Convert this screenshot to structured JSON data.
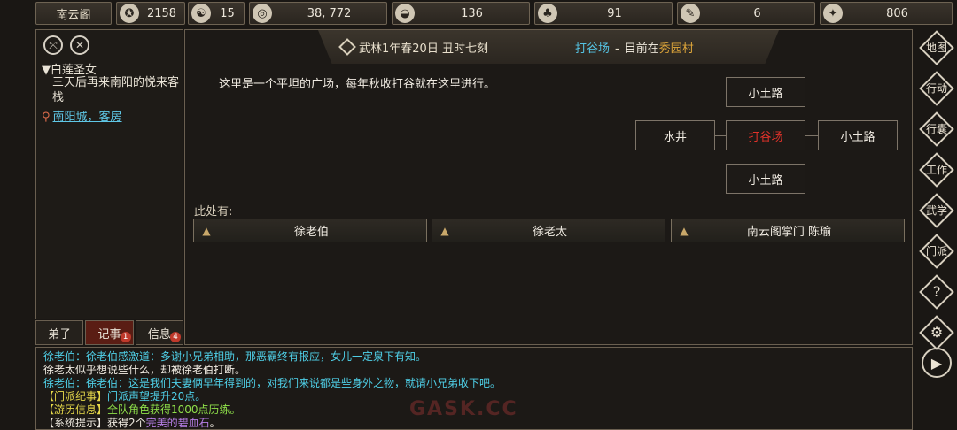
{
  "topbar": {
    "title": "南云阁",
    "stats": [
      {
        "icon": "prestige-icon",
        "glyph": "✪",
        "value": "2158"
      },
      {
        "icon": "yinyang-icon",
        "glyph": "☯",
        "value": "15"
      },
      {
        "icon": "coin-icon",
        "glyph": "◎",
        "value": "38, 772"
      },
      {
        "icon": "food-bowl-icon",
        "glyph": "◒",
        "value": "136"
      },
      {
        "icon": "herb-icon",
        "glyph": "♣",
        "value": "91"
      },
      {
        "icon": "scroll-icon",
        "glyph": "✎",
        "value": "6"
      },
      {
        "icon": "beast-icon",
        "glyph": "✦",
        "value": "806"
      }
    ]
  },
  "left": {
    "task_title": "▼白莲圣女",
    "task_desc": "三天后再来南阳的悦来客栈",
    "task_location": "南阳城，客房"
  },
  "tabs": [
    {
      "label": "弟子",
      "badge": ""
    },
    {
      "label": "记事",
      "badge": "1"
    },
    {
      "label": "信息",
      "badge": "4"
    }
  ],
  "header": {
    "date": "武林1年春20日 丑时七刻",
    "place": "打谷场",
    "separator": "-",
    "current_prefix": "目前在",
    "village": "秀园村"
  },
  "scene": {
    "description": "这里是一个平坦的广场，每年秋收打谷就在这里进行。",
    "map": {
      "north": "小土路",
      "west": "水井",
      "center": "打谷场",
      "east": "小土路",
      "south": "小土路"
    },
    "here_label": "此处有:",
    "npcs": [
      "徐老伯",
      "徐老太",
      "南云阁掌门 陈瑜"
    ]
  },
  "log": {
    "line1": "徐老伯：徐老伯感激道：多谢小兄弟相助，那恶霸终有报应，女儿一定泉下有知。",
    "line2": "徐老太似乎想说些什么，却被徐老伯打断。",
    "line3": "徐老伯：徐老伯：这是我们夫妻俩早年得到的，对我们来说都是些身外之物，就请小兄弟收下吧。",
    "line4_tag": "【门派纪事】",
    "line4_text": "门派声望提升20点。",
    "line5_tag": "【游历信息】",
    "line5_text": "全队角色获得1000点历练。",
    "line6_tag": "【系统提示】",
    "line6_text": "获得2个",
    "line6_item": "完美的碧血石",
    "line6_end": "。"
  },
  "watermark": "GASK.CC",
  "rightbar": {
    "map": "地图",
    "action": "行动",
    "bag": "行囊",
    "work": "工作",
    "martial": "武学",
    "sect": "门派",
    "help": "?",
    "settings": "⚙",
    "play": "▶"
  }
}
